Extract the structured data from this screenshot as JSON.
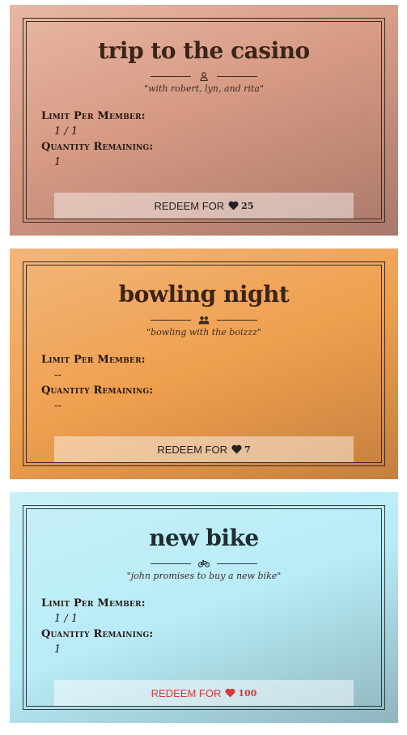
{
  "cards": [
    {
      "title": "trip to the casino",
      "icon": "person-icon",
      "subtitle": "\"with robert, lyn, and rita\"",
      "limit_label": "Limit Per Member:",
      "limit_value": "1 / 1",
      "quantity_label": "Quantity Remaining:",
      "quantity_value": "1",
      "redeem_label": "REDEEM FOR",
      "cost": "25",
      "background": "#d69a83"
    },
    {
      "title": "bowling night",
      "icon": "group-icon",
      "subtitle": "\"bowling with the boizzz\"",
      "limit_label": "Limit Per Member:",
      "limit_value": "--",
      "quantity_label": "Quantity Remaining:",
      "quantity_value": "--",
      "redeem_label": "REDEEM FOR",
      "cost": "7",
      "background": "#efa04f"
    },
    {
      "title": "new bike",
      "icon": "bicycle-icon",
      "subtitle": "\"john promises to buy a new bike\"",
      "limit_label": "Limit Per Member:",
      "limit_value": "1 / 1",
      "quantity_label": "Quantity Remaining:",
      "quantity_value": "1",
      "redeem_label": "REDEEM FOR",
      "cost": "100",
      "background": "#b8ecf8",
      "accent": "#d83a3a"
    }
  ]
}
